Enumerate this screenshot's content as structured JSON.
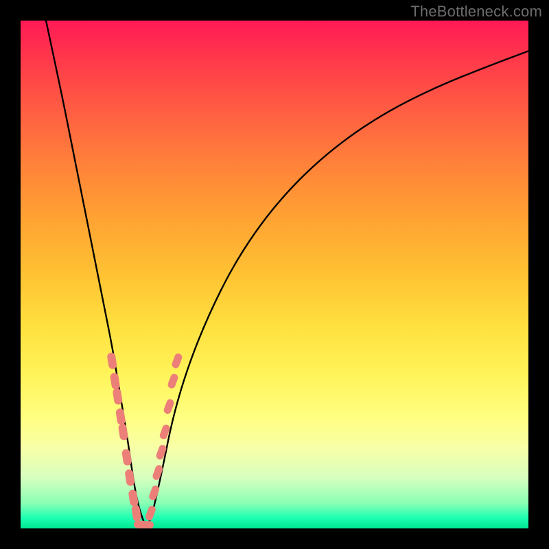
{
  "watermark": "TheBottleneck.com",
  "chart_data": {
    "type": "line",
    "title": "",
    "xlabel": "",
    "ylabel": "",
    "xlim": [
      0,
      100
    ],
    "ylim": [
      0,
      100
    ],
    "series": [
      {
        "name": "bottleneck-curve",
        "x": [
          5,
          8,
          10,
          12,
          14,
          16,
          18,
          19,
          20,
          21,
          22,
          23,
          24.5,
          25,
          26,
          28,
          30,
          33,
          37,
          42,
          48,
          55,
          63,
          72,
          82,
          92,
          100
        ],
        "y": [
          100,
          86,
          76,
          66,
          56,
          46,
          36,
          30,
          24,
          18,
          11,
          5,
          0.5,
          0.5,
          3,
          12,
          22,
          32,
          42,
          52,
          61,
          69,
          76,
          82,
          87,
          91,
          94
        ]
      }
    ],
    "highlight_ranges_pct": {
      "left": {
        "x_start": 17.5,
        "x_end": 23.0
      },
      "right": {
        "x_start": 25.5,
        "x_end": 30.5
      }
    },
    "markers": {
      "comment": "decorative salmon capsule markers along lower arms of the V",
      "color": "#ec8079",
      "left_arm_points": [
        [
          18.0,
          33
        ],
        [
          18.6,
          29
        ],
        [
          19.1,
          26
        ],
        [
          19.7,
          22
        ],
        [
          20.2,
          19
        ],
        [
          20.9,
          14
        ],
        [
          21.5,
          10
        ],
        [
          22.2,
          6
        ],
        [
          22.8,
          3
        ]
      ],
      "right_arm_points": [
        [
          25.6,
          3
        ],
        [
          26.3,
          7
        ],
        [
          27.0,
          11
        ],
        [
          27.7,
          15
        ],
        [
          28.4,
          19
        ],
        [
          29.2,
          24
        ],
        [
          30.0,
          29
        ],
        [
          30.8,
          33
        ]
      ],
      "bottom_points": [
        [
          23.5,
          0.8
        ],
        [
          24.2,
          0.6
        ],
        [
          25.0,
          0.7
        ]
      ]
    }
  }
}
